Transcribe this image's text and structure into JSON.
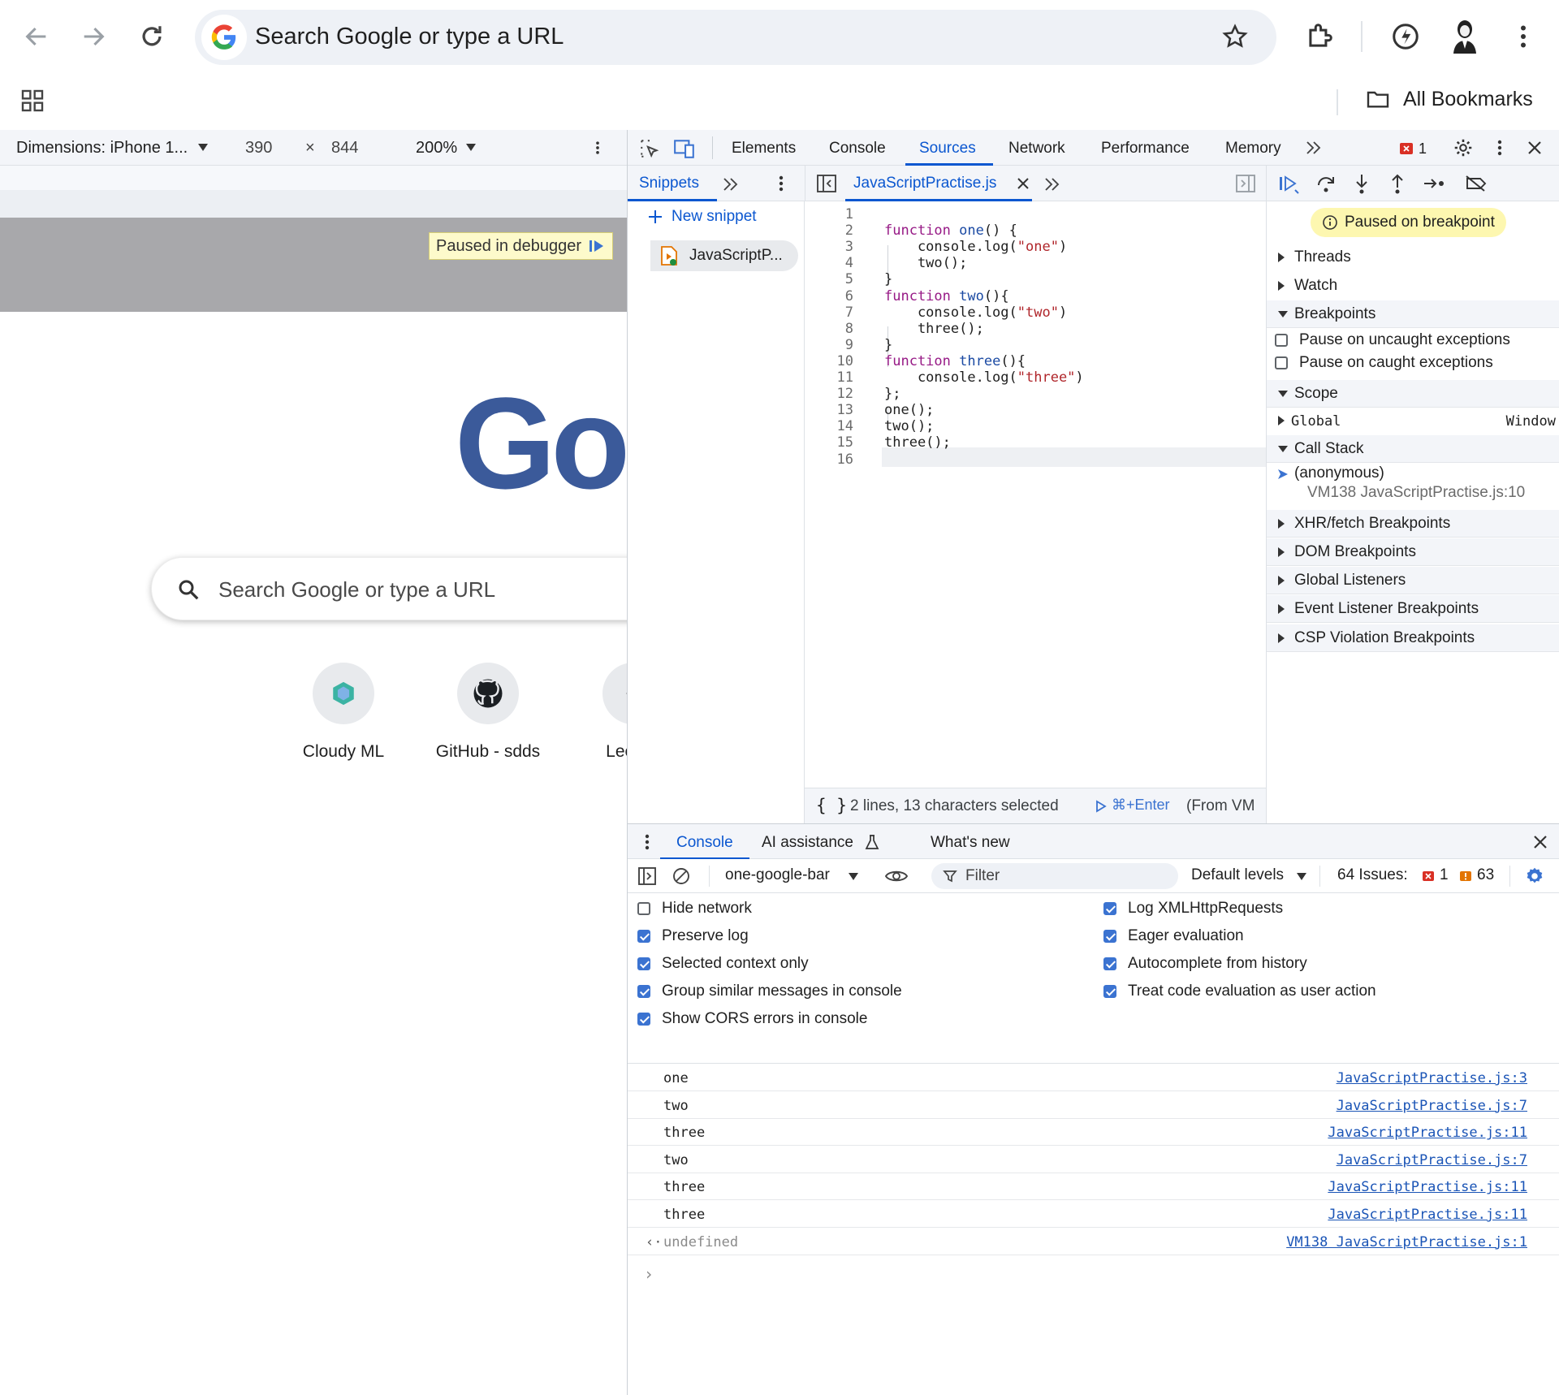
{
  "browser": {
    "omnibox_placeholder": "Search Google or type a URL",
    "bookmarks_label": "All Bookmarks"
  },
  "emulation": {
    "dimensions_label": "Dimensions: iPhone 1...",
    "width": "390",
    "times": "×",
    "height": "844",
    "zoom": "200%"
  },
  "page": {
    "paused_label": "Paused in debugger",
    "logo_text": "Goo",
    "search_placeholder": "Search Google or type a URL",
    "shortcuts": [
      {
        "label": "Cloudy ML"
      },
      {
        "label": "GitHub - sdds"
      },
      {
        "label": "LeetCo"
      }
    ]
  },
  "devtools": {
    "tabs": [
      "Elements",
      "Console",
      "Sources",
      "Network",
      "Performance",
      "Memory"
    ],
    "active_tab": "Sources",
    "error_count": "1",
    "navigator": {
      "tab": "Snippets",
      "new_snippet": "New snippet",
      "file": "JavaScriptP..."
    },
    "editor": {
      "open_file": "JavaScriptPractise.js",
      "lines": [
        {
          "n": "1",
          "html": ""
        },
        {
          "n": "2",
          "html": "<span class='kw'>function</span> <span class='fn'>one</span>() {"
        },
        {
          "n": "3",
          "html": "    console.log(<span class='str'>\"one\"</span>)"
        },
        {
          "n": "4",
          "html": "    two();"
        },
        {
          "n": "5",
          "html": "}"
        },
        {
          "n": "6",
          "html": "<span class='kw'>function</span> <span class='fn'>two</span>(){"
        },
        {
          "n": "7",
          "html": "    console.log(<span class='str'>\"two\"</span>)"
        },
        {
          "n": "8",
          "html": "    three();"
        },
        {
          "n": "9",
          "html": "}"
        },
        {
          "n": "10",
          "html": "<span class='kw'>function</span> <span class='fn'>three</span>(){"
        },
        {
          "n": "11",
          "html": "    console.log(<span class='str'>\"three\"</span>)"
        },
        {
          "n": "12",
          "html": "};"
        },
        {
          "n": "13",
          "html": "one();"
        },
        {
          "n": "14",
          "html": "two();"
        },
        {
          "n": "15",
          "html": "three();"
        },
        {
          "n": "16",
          "html": ""
        }
      ],
      "status": "2 lines, 13 characters selected",
      "run_hint": "⌘+Enter",
      "from": "(From VM"
    },
    "debugger": {
      "paused": "Paused on breakpoint",
      "threads": "Threads",
      "watch": "Watch",
      "breakpoints": "Breakpoints",
      "pause_uncaught": "Pause on uncaught exceptions",
      "pause_caught": "Pause on caught exceptions",
      "scope": "Scope",
      "global": "Global",
      "global_value": "Window",
      "call_stack": "Call Stack",
      "frame_name": "(anonymous)",
      "frame_loc": "VM138 JavaScriptPractise.js:10",
      "xhr": "XHR/fetch Breakpoints",
      "dom": "DOM Breakpoints",
      "global_listeners": "Global Listeners",
      "event_listeners": "Event Listener Breakpoints",
      "csp": "CSP Violation Breakpoints"
    },
    "drawer": {
      "tabs": [
        "Console",
        "AI assistance",
        "What's new"
      ],
      "context": "one-google-bar",
      "filter_placeholder": "Filter",
      "levels": "Default levels",
      "issues_label": "64 Issues:",
      "issues_errors": "1",
      "issues_warnings": "63",
      "settings_left": [
        {
          "label": "Hide network",
          "checked": false
        },
        {
          "label": "Preserve log",
          "checked": true
        },
        {
          "label": "Selected context only",
          "checked": true
        },
        {
          "label": "Group similar messages in console",
          "checked": true
        },
        {
          "label": "Show CORS errors in console",
          "checked": true
        }
      ],
      "settings_right": [
        {
          "label": "Log XMLHttpRequests",
          "checked": true
        },
        {
          "label": "Eager evaluation",
          "checked": true
        },
        {
          "label": "Autocomplete from history",
          "checked": true
        },
        {
          "label": "Treat code evaluation as user action",
          "checked": true
        }
      ],
      "messages": [
        {
          "text": "one",
          "source": "JavaScriptPractise.js:3"
        },
        {
          "text": "two",
          "source": "JavaScriptPractise.js:7"
        },
        {
          "text": "three",
          "source": "JavaScriptPractise.js:11"
        },
        {
          "text": "two",
          "source": "JavaScriptPractise.js:7"
        },
        {
          "text": "three",
          "source": "JavaScriptPractise.js:11"
        },
        {
          "text": "three",
          "source": "JavaScriptPractise.js:11"
        }
      ],
      "result": {
        "text": "undefined",
        "source": "VM138 JavaScriptPractise.js:1"
      }
    }
  },
  "colors": {
    "accent": "#0b57d0",
    "logo": "#3b5a9a",
    "paused_badge": "#fdfacb"
  }
}
